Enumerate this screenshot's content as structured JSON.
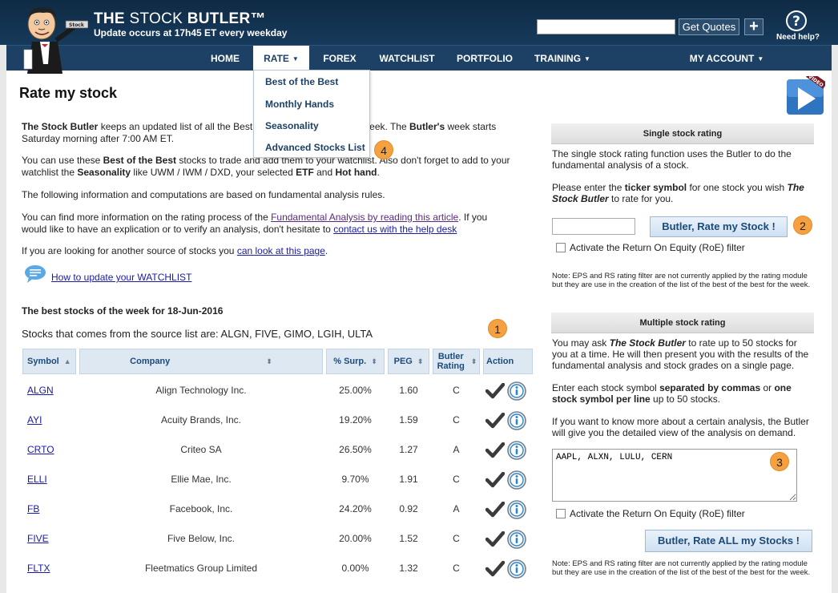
{
  "header": {
    "title_bold_1": "THE",
    "title_light": "STOCK",
    "title_bold_2": "BUTLER™",
    "subtitle": "Update occurs at 17h45 ET every weekday",
    "quote_input_value": "",
    "get_quotes_label": "Get Quotes",
    "plus_label": "+",
    "help_label": "Need help?",
    "logo_sign_text": "Stock"
  },
  "nav": {
    "items": [
      "HOME",
      "RATE",
      "FOREX",
      "WATCHLIST",
      "PORTFOLIO",
      "TRAINING",
      "MY ACCOUNT"
    ]
  },
  "dropdown": {
    "items": [
      "Best of the Best",
      "Monthly Hands",
      "Seasonality",
      "Advanced Stocks List"
    ]
  },
  "page": {
    "title": "Rate my stock",
    "video_label": "VIDEO",
    "p1_b1": "The Stock Butler",
    "p1_t1": " keeps an updated list of all the Best",
    "p1_t2": "eek. The ",
    "p1_b2": "Butler's",
    "p1_t3": " week starts",
    "p1_line2": "Saturday morning after 7:00 AM ET.",
    "p2_t1": "You can use these ",
    "p2_b1": "Best of the Best",
    "p2_t2": " stocks to trade and add them to your watchlist. Also don't forget to add to your",
    "p2_t3": "watchlist the ",
    "p2_b2": "Seasonality",
    "p2_t4": " like UWM / IWM / DXD, your selected ",
    "p2_b3": "ETF",
    "p2_t5": " and ",
    "p2_b4": "Hot hand",
    "p2_t6": ".",
    "p3": "The following information and computations are based on fundamental analysis rules.",
    "p4_t1": "You can find more information on the rating process of the ",
    "p4_link1": "Fundamental Analysis by reading this article",
    "p4_t2": ". If you",
    "p4_t3": "would like to have an explication or to verify an analysis, don't hesitate to ",
    "p4_link2": "contact us with the help desk",
    "p5_t1": "If you are looking for another source of stocks you ",
    "p5_link": "can look at this page",
    "p5_t2": ".",
    "watchlist_link": "How to update your WATCHLIST",
    "best_title": "The best stocks of the week for 18-Jun-2016",
    "source_line": "Stocks that comes from the source list are: ALGN, FIVE, GIMO, LGIH, ULTA"
  },
  "badges": [
    "1",
    "2",
    "3",
    "4"
  ],
  "table": {
    "headers": [
      "Symbol",
      "Company",
      "% Surp.",
      "PEG",
      "Butler Rating",
      "Action"
    ],
    "rows": [
      {
        "symbol": "ALGN",
        "company": "Align Technology Inc.",
        "surp": "25.00%",
        "peg": "1.60",
        "rating": "C"
      },
      {
        "symbol": "AYI",
        "company": "Acuity Brands, Inc.",
        "surp": "19.20%",
        "peg": "1.59",
        "rating": "C"
      },
      {
        "symbol": "CRTO",
        "company": "Criteo SA",
        "surp": "26.50%",
        "peg": "1.27",
        "rating": "A"
      },
      {
        "symbol": "ELLI",
        "company": "Ellie Mae, Inc.",
        "surp": "9.70%",
        "peg": "1.91",
        "rating": "C"
      },
      {
        "symbol": "FB",
        "company": "Facebook, Inc.",
        "surp": "24.20%",
        "peg": "0.92",
        "rating": "A"
      },
      {
        "symbol": "FIVE",
        "company": "Five Below, Inc.",
        "surp": "20.00%",
        "peg": "1.52",
        "rating": "C"
      },
      {
        "symbol": "FLTX",
        "company": "Fleetmatics Group Limited",
        "surp": "0.00%",
        "peg": "1.32",
        "rating": "C"
      }
    ]
  },
  "sidebar": {
    "single_title": "Single stock rating",
    "single_p1": "The single stock rating function uses the Butler to do the fundamental analysis of a stock.",
    "single_p2_t1": "Please enter the ",
    "single_p2_b1": "ticker symbol",
    "single_p2_t2": " for one stock you wish ",
    "single_p2_b2": "The Stock Butler",
    "single_p2_t3": " to rate for you.",
    "ticker_value": "",
    "rate_btn": "Butler, Rate my Stock !",
    "roe_label": "Activate the Return On Equity (RoE) filter",
    "note": "Note: EPS and RS rating filter are not currently applied by the rating module but they are use in the creation of the list of the best of the best for the week.",
    "multi_title": "Multiple stock rating",
    "multi_p1_t1": "You may ask ",
    "multi_p1_b1": "The Stock Butler",
    "multi_p1_t2": " to rate up to 50 stocks for you at a time. He will then present you with the results of the fundamental analysis and stock grades on a single page.",
    "multi_p2_t1": "Enter each stock symbol ",
    "multi_p2_b1": "separated by commas",
    "multi_p2_t2": " or ",
    "multi_p2_b2": "one stock symbol per line",
    "multi_p2_t3": " up to 50 stocks.",
    "multi_p3": "If you want to know more about a certain analysis, the Butler will give you the detailed view of the analysis on demand.",
    "symbols_value": "AAPL, ALXN, LULU, CERN",
    "rate_all_btn": "Butler, Rate ALL my Stocks !"
  }
}
